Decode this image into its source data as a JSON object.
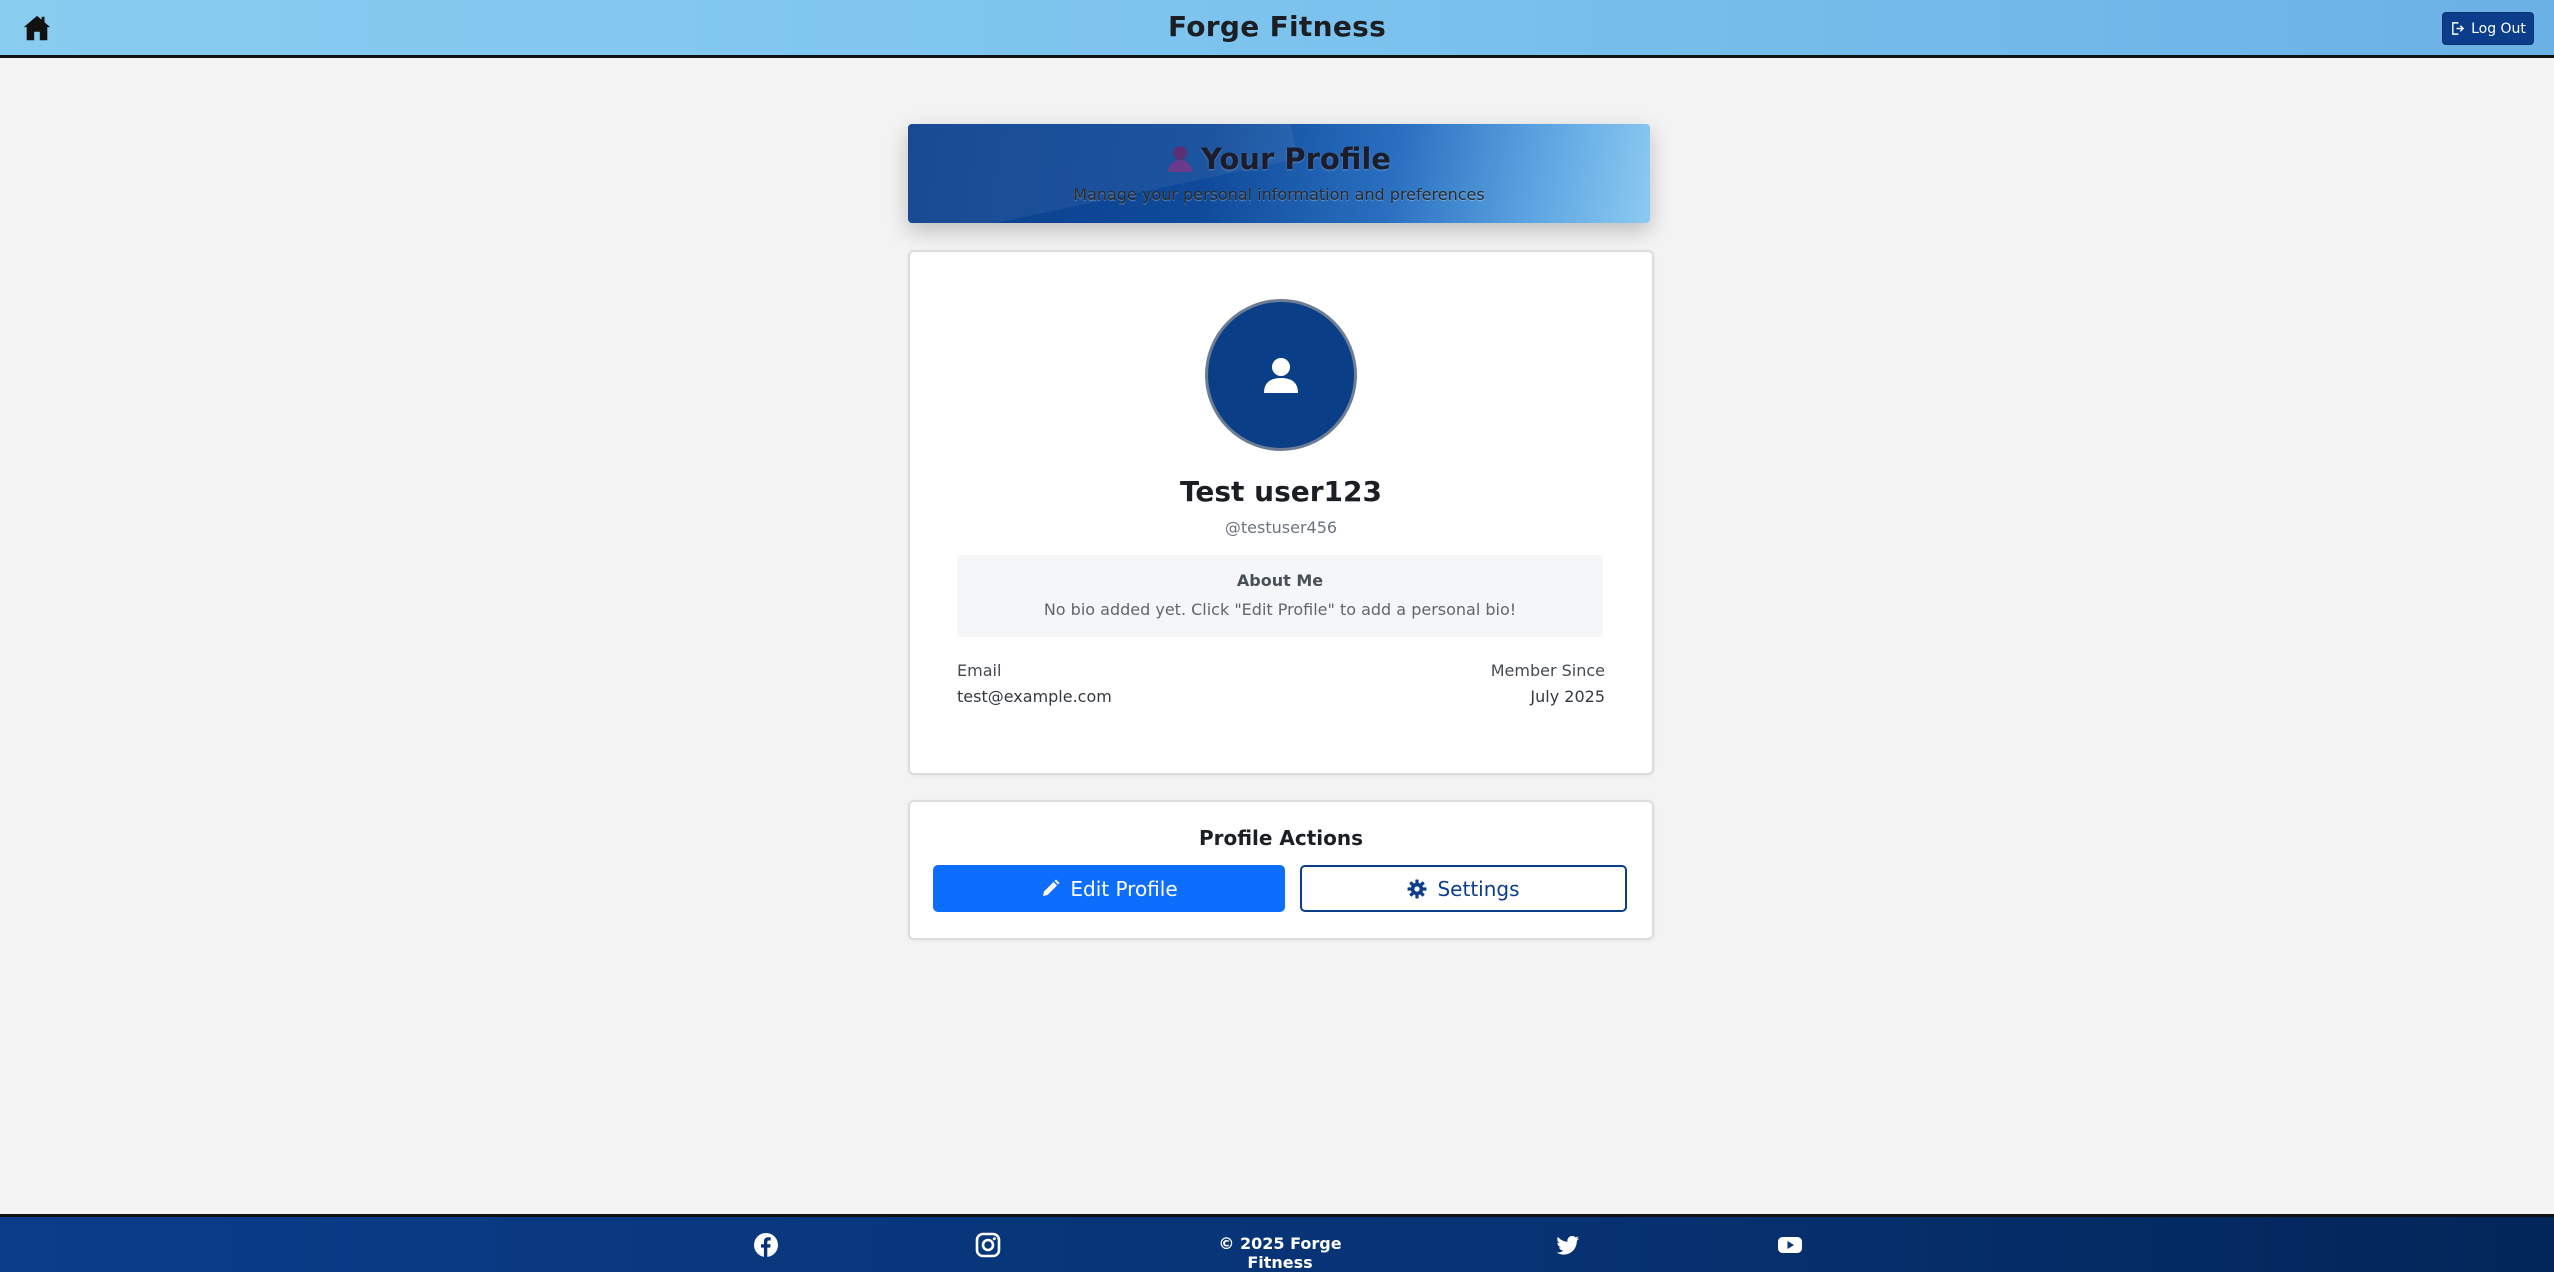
{
  "nav": {
    "brand": "Forge Fitness",
    "home_icon": "home-icon",
    "logout_label": "Log Out",
    "logout_icon": "logout-icon"
  },
  "banner": {
    "title": "Your Profile",
    "title_icon": "person-emoji-icon",
    "subtitle": "Manage your personal information and preferences"
  },
  "profile": {
    "avatar_icon": "user-icon",
    "name": "Test user123",
    "handle": "@testuser456",
    "about_title": "About Me",
    "about_text": "No bio added yet. Click \"Edit Profile\" to add a personal bio!",
    "email_label": "Email",
    "email_value": "test@example.com",
    "member_label": "Member Since",
    "member_value": "July 2025"
  },
  "actions": {
    "title": "Profile Actions",
    "edit_label": "Edit Profile",
    "edit_icon": "pencil-icon",
    "settings_label": "Settings",
    "settings_icon": "gear-icon"
  },
  "footer": {
    "copyright": "© 2025 Forge Fitness",
    "social_icons": [
      "facebook-icon",
      "instagram-icon",
      "twitter-icon",
      "youtube-icon"
    ]
  },
  "colors": {
    "nav_bg": "#7cc3ee",
    "primary": "#0d6efd",
    "navy": "#0b3d8a",
    "page_bg": "#f3f3f3"
  }
}
